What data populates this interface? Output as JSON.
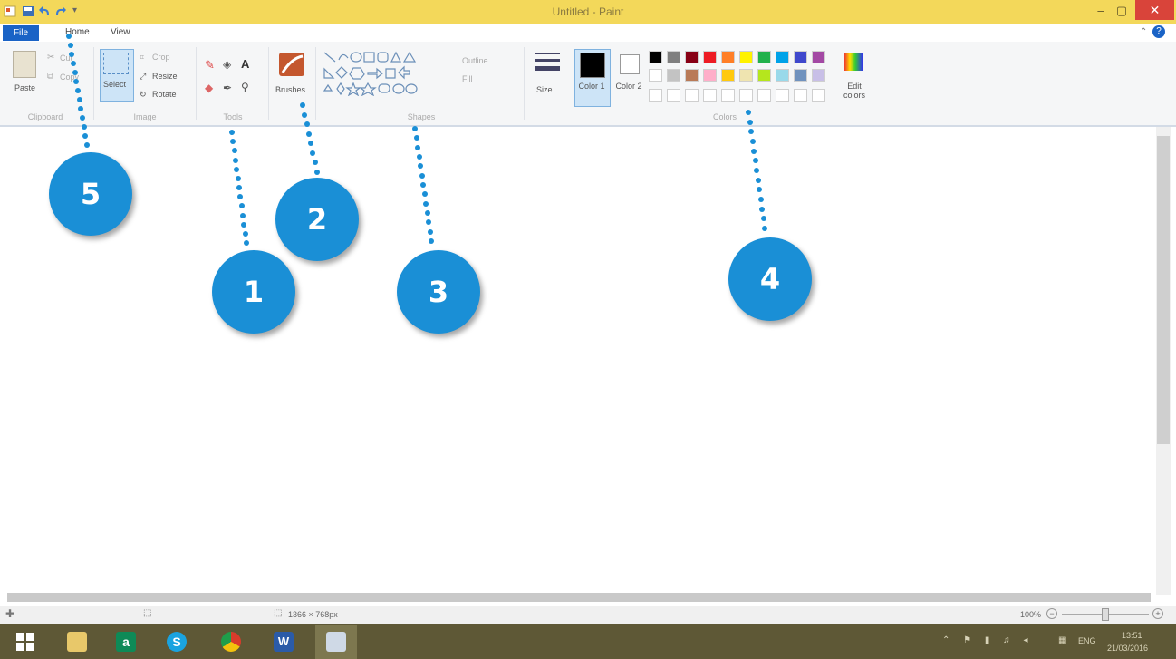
{
  "window": {
    "title": "Untitled - Paint",
    "minimize": "–",
    "maximize": "▢",
    "close": "✕"
  },
  "tabs": {
    "file": "File",
    "home": "Home",
    "view": "View"
  },
  "ribbon": {
    "clipboard": {
      "paste": "Paste",
      "cut": "Cut",
      "copy": "Copy",
      "label": "Clipboard"
    },
    "image": {
      "select": "Select",
      "crop": "Crop",
      "resize": "Resize",
      "rotate": "Rotate",
      "label": "Image"
    },
    "tools": {
      "label": "Tools"
    },
    "brushes": {
      "label": "Brushes"
    },
    "shapes": {
      "outline": "Outline",
      "fill": "Fill",
      "label": "Shapes"
    },
    "size": {
      "label": "Size"
    },
    "colors": {
      "color1": "Color 1",
      "color2": "Color 2",
      "edit": "Edit colors",
      "label": "Colors",
      "palette_row1": [
        "#000000",
        "#7f7f7f",
        "#880015",
        "#ed1c24",
        "#ff7f27",
        "#fff200",
        "#22b14c",
        "#00a2e8",
        "#3f48cc",
        "#a349a4"
      ],
      "palette_row2": [
        "#ffffff",
        "#c3c3c3",
        "#b97a57",
        "#ffaec9",
        "#ffc90e",
        "#efe4b0",
        "#b5e61d",
        "#99d9ea",
        "#7092be",
        "#c8bfe7"
      ]
    }
  },
  "status": {
    "canvas_size": "1366 × 768px",
    "zoom": "100%"
  },
  "taskbar": {
    "lang": "ENG",
    "time": "13:51",
    "date": "21/03/2016"
  },
  "callouts": [
    "1",
    "2",
    "3",
    "4",
    "5"
  ]
}
